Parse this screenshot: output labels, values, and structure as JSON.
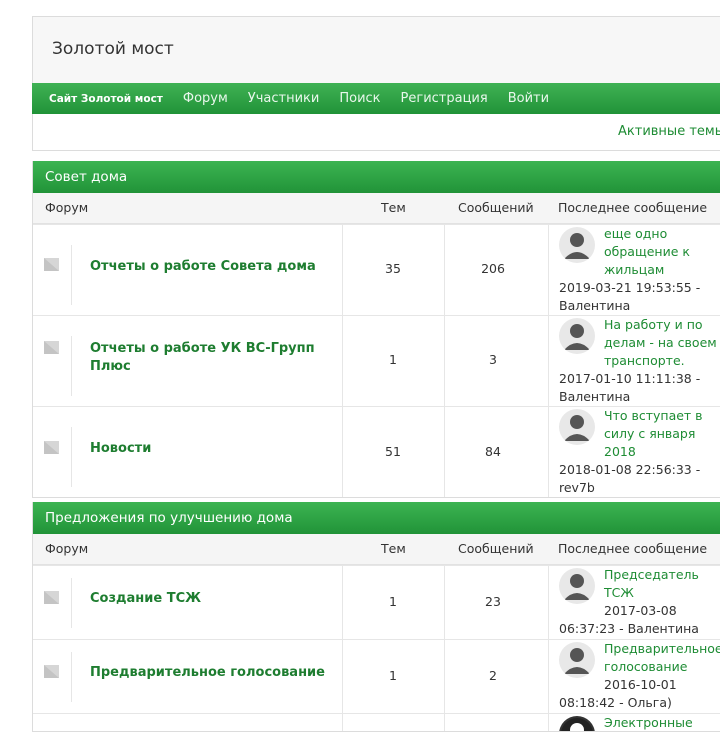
{
  "site": {
    "title": "Золотой мост"
  },
  "nav": {
    "brand": "Сайт Золотой мост",
    "items": [
      "Форум",
      "Участники",
      "Поиск",
      "Регистрация",
      "Войти"
    ]
  },
  "subbar": {
    "active_topics": "Активные темы"
  },
  "columns": {
    "forum": "Форум",
    "topics": "Тем",
    "posts": "Сообщений",
    "last": "Последнее сообщение"
  },
  "categories": [
    {
      "title": "Совет дома",
      "forums": [
        {
          "name": "Отчеты о работе Совета дома",
          "topics": "35",
          "posts": "206",
          "last_title_lines": [
            "еще одно",
            "обращение к",
            "жильцам"
          ],
          "last_meta_lines": [
            "2019-03-21 19:53:55 -",
            "Валентина"
          ]
        },
        {
          "name_lines": [
            "Отчеты о работе УК ВС-Групп",
            "Плюс"
          ],
          "topics": "1",
          "posts": "3",
          "last_title_lines": [
            "На работу и по",
            "делам - на своем",
            "транспорте."
          ],
          "last_meta_lines": [
            "2017-01-10 11:11:38 -",
            "Валентина"
          ]
        },
        {
          "name": "Новости",
          "topics": "51",
          "posts": "84",
          "last_title_lines": [
            "Что вступает в",
            "силу с января",
            "2018"
          ],
          "last_meta_lines": [
            "2018-01-08 22:56:33 -",
            "rev7b"
          ]
        }
      ]
    },
    {
      "title": "Предложения по улучшению дома",
      "forums": [
        {
          "name": "Создание ТСЖ",
          "topics": "1",
          "posts": "23",
          "last_title_lines": [
            "Председатель",
            "ТСЖ"
          ],
          "last_meta_lines": [
            "2017-03-08",
            "06:37:23 - Валентина"
          ]
        },
        {
          "name": "Предварительное голосование",
          "topics": "1",
          "posts": "2",
          "last_title_lines": [
            "Предварительное",
            "голосование"
          ],
          "last_meta_lines": [
            "2016-10-01",
            "08:18:42 - Ольга)"
          ]
        },
        {
          "last_title_lines": [
            "Электронные"
          ]
        }
      ]
    }
  ],
  "colors": {
    "accent": "#219338",
    "link": "#1e8c34"
  }
}
